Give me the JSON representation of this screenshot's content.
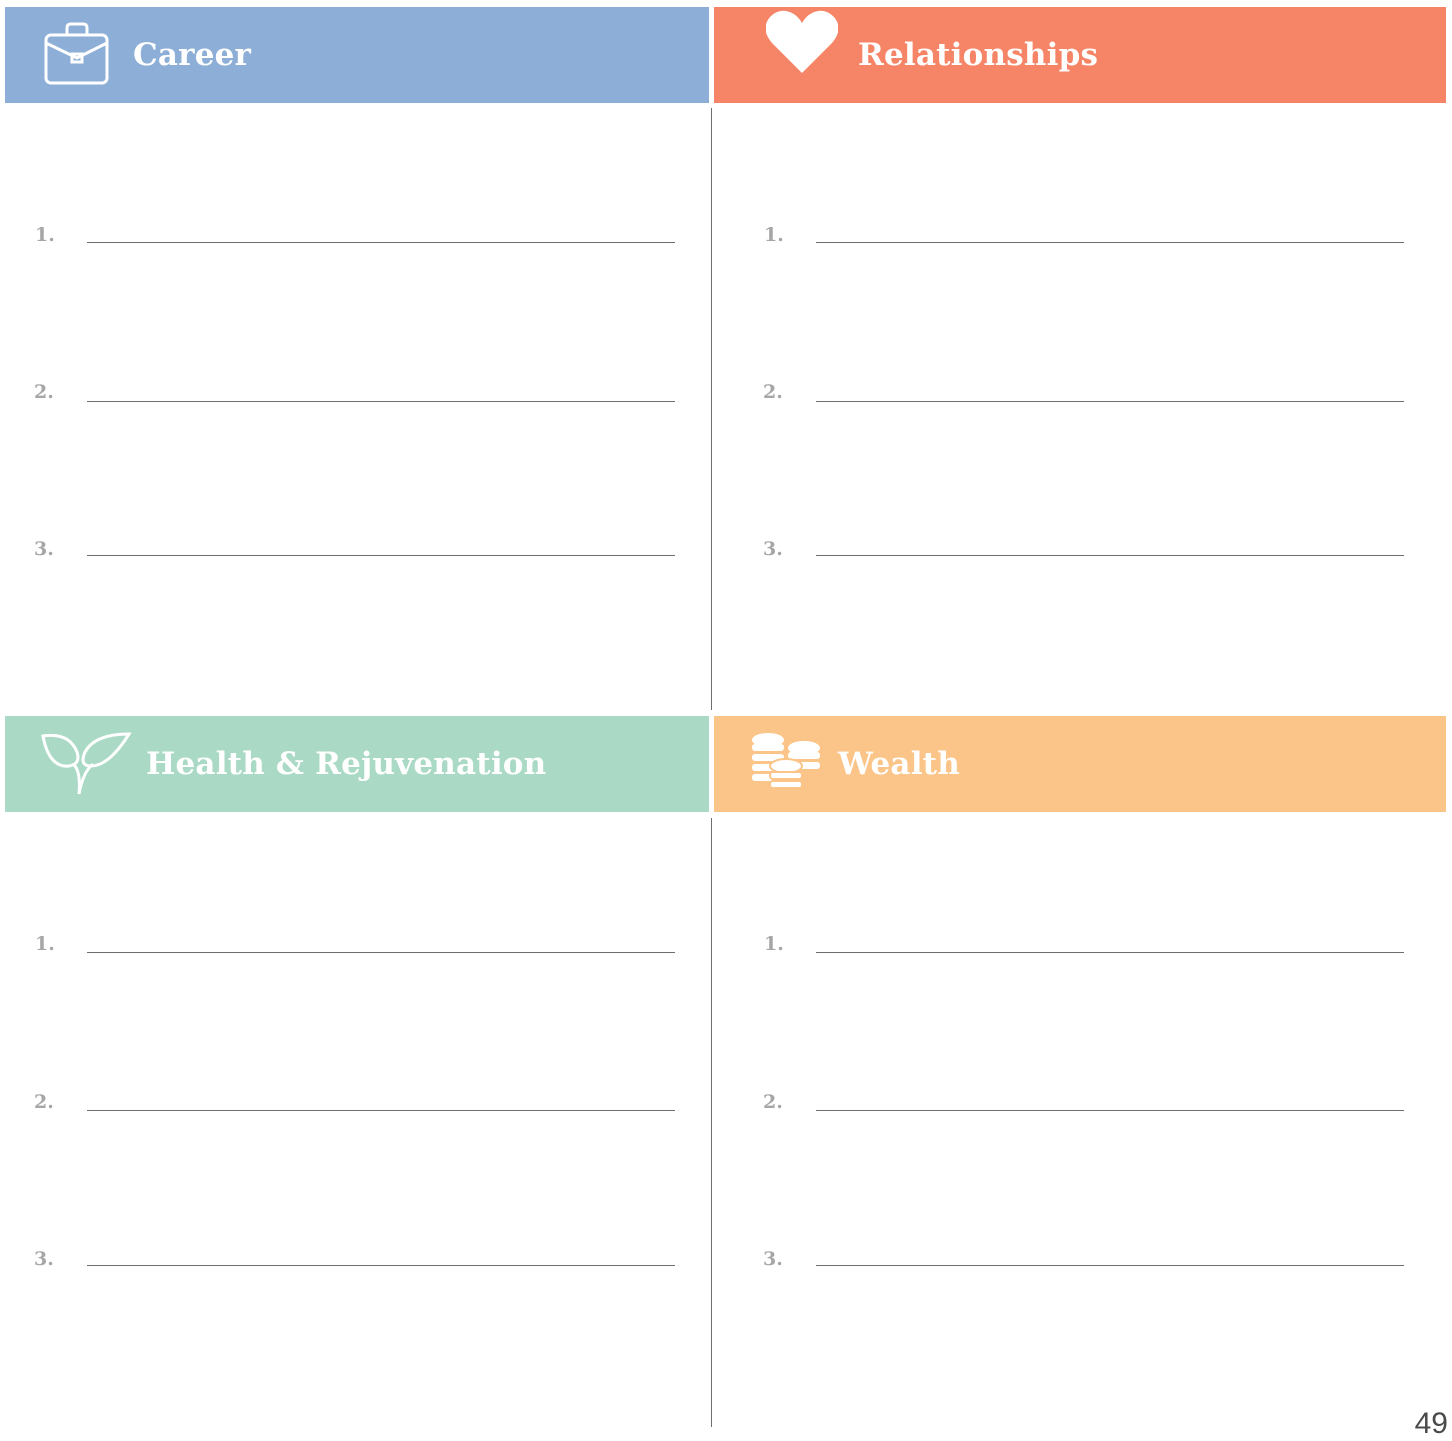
{
  "quadrants": [
    {
      "key": "career",
      "title": "Career",
      "color": "#8DAFD7",
      "icon": "briefcase-icon",
      "items": [
        "1.",
        "2.",
        "3."
      ]
    },
    {
      "key": "relationships",
      "title": "Relationships",
      "color": "#F68568",
      "icon": "heart-icon",
      "items": [
        "1.",
        "2.",
        "3."
      ]
    },
    {
      "key": "health",
      "title": "Health & Rejuvenation",
      "color": "#AADAC5",
      "icon": "leaf-icon",
      "items": [
        "1.",
        "2.",
        "3."
      ]
    },
    {
      "key": "wealth",
      "title": "Wealth",
      "color": "#FBC589",
      "icon": "coins-icon",
      "items": [
        "1.",
        "2.",
        "3."
      ]
    }
  ],
  "page_number": "49"
}
